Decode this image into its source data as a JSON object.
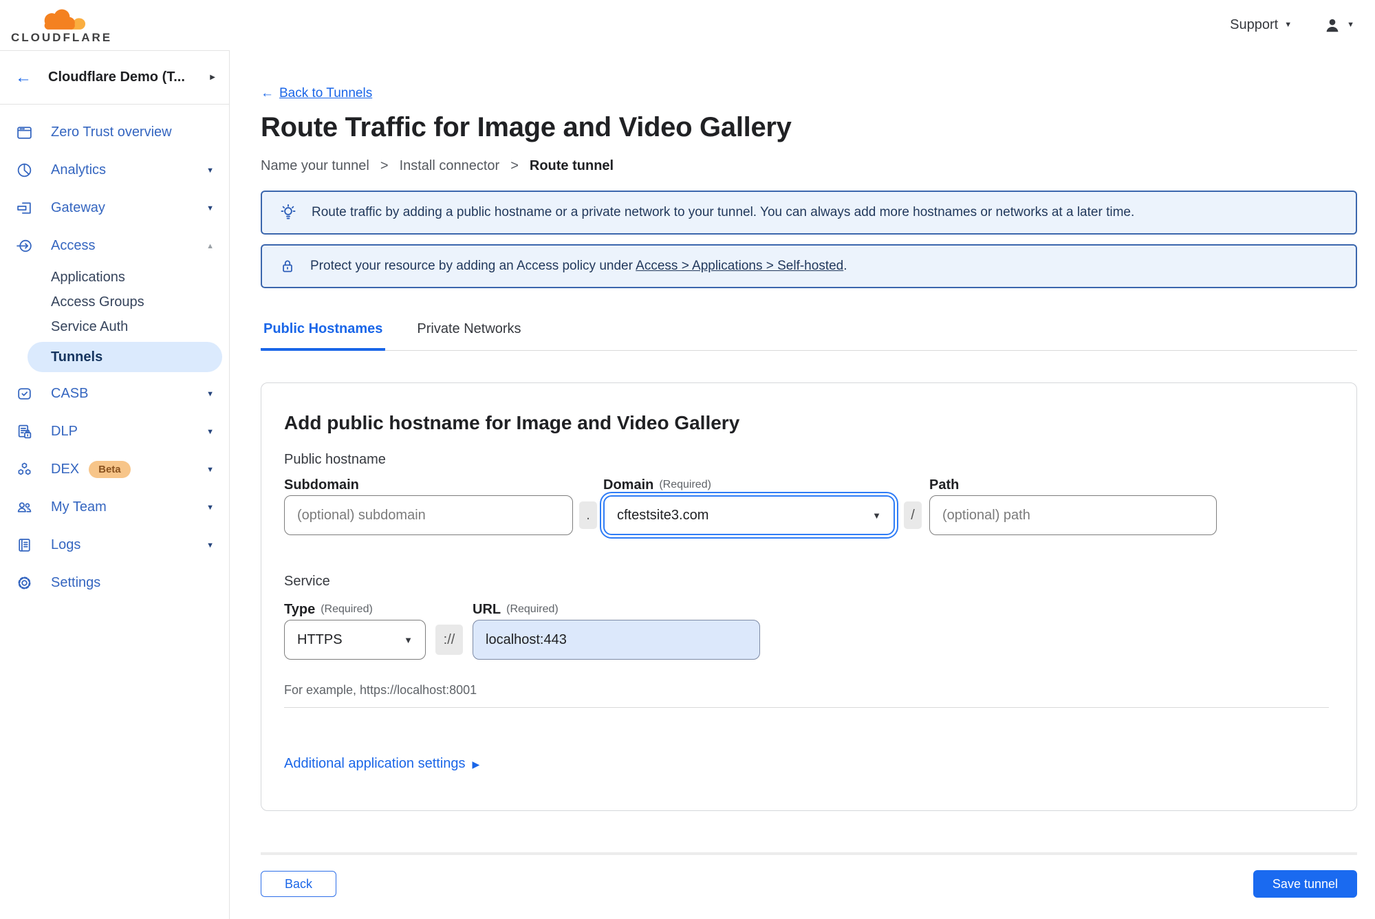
{
  "topbar": {
    "logo_text": "CLOUDFLARE",
    "support_label": "Support"
  },
  "sidebar": {
    "account_label": "Cloudflare Demo (T...",
    "items": [
      {
        "label": "Zero Trust overview"
      },
      {
        "label": "Analytics"
      },
      {
        "label": "Gateway"
      },
      {
        "label": "Access"
      },
      {
        "label": "CASB"
      },
      {
        "label": "DLP"
      },
      {
        "label": "DEX",
        "badge": "Beta"
      },
      {
        "label": "My Team"
      },
      {
        "label": "Logs"
      },
      {
        "label": "Settings"
      }
    ],
    "access_children": [
      {
        "label": "Applications"
      },
      {
        "label": "Access Groups"
      },
      {
        "label": "Service Auth"
      },
      {
        "label": "Tunnels",
        "active": true
      }
    ]
  },
  "page": {
    "back": {
      "arrow": "←",
      "label": "Back to Tunnels"
    },
    "title": "Route Traffic for Image and Video Gallery",
    "breadcrumb": {
      "step1": "Name your tunnel",
      "sep": ">",
      "step2": "Install connector",
      "step3": "Route tunnel"
    }
  },
  "banners": {
    "tip_text": "Route traffic by adding a public hostname or a private network to your tunnel. You can always add more hostnames or networks at a later time.",
    "protect_prefix": "Protect your resource by adding an Access policy under",
    "protect_link": "Access > Applications > Self-hosted",
    "protect_suffix": "."
  },
  "tabs": {
    "public": "Public Hostnames",
    "private": "Private Networks",
    "active": "Public Hostnames"
  },
  "form": {
    "card_title": "Add public hostname for Image and Video Gallery",
    "public_hostname_label": "Public hostname",
    "subdomain_label": "Subdomain",
    "subdomain_placeholder": "(optional) subdomain",
    "dot_separator": ".",
    "domain_label": "Domain",
    "required_hint": "(Required)",
    "domain_value": "cftestsite3.com",
    "slash_separator": "/",
    "path_label": "Path",
    "path_placeholder": "(optional) path",
    "service_label": "Service",
    "type_label": "Type",
    "type_value": "HTTPS",
    "scheme_separator": "://",
    "url_label": "URL",
    "url_value": "localhost:443",
    "example_text": "For example, https://localhost:8001",
    "additional_settings_label": "Additional application settings"
  },
  "footer": {
    "back_label": "Back",
    "save_label": "Save tunnel"
  },
  "icons": {
    "caret_down": "▼",
    "caret_up": "▲",
    "caret_right": "▶",
    "back_arrow": "←"
  },
  "colors": {
    "accent_blue": "#1a66e8",
    "primary_button": "#1a6af0",
    "focus_ring": "#2e7cf6",
    "banner_border": "#3b66ad",
    "banner_bg": "#ecf3fc",
    "active_item_bg": "#dbeafd",
    "beta_badge_bg": "#f7c589",
    "url_field_bg": "#dce8fb",
    "brand_orange": "#f48120",
    "brand_orange_light": "#faae40"
  }
}
